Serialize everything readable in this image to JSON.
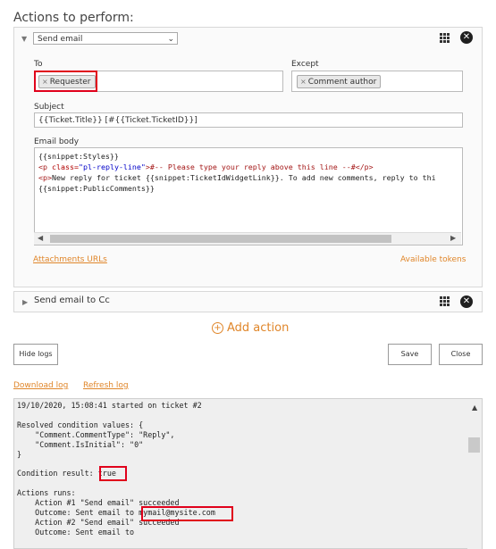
{
  "header": {
    "title": "Actions to perform:"
  },
  "action1": {
    "type_select": "Send email",
    "to": {
      "label": "To",
      "chip": "Requester"
    },
    "except": {
      "label": "Except",
      "chip": "Comment author"
    },
    "subject": {
      "label": "Subject",
      "value": "{{Ticket.Title}} [#{{Ticket.TicketID}}]"
    },
    "email_body": {
      "label": "Email body",
      "lines": [
        "{{snippet:Styles}}",
        "<p class=\"pl-reply-line\">#-- Please type your reply above this line --#</p>",
        "<p>New reply for ticket {{snippet:TicketIdWidgetLink}}. To add new comments, reply to thi",
        "{{snippet:PublicComments}}"
      ],
      "line2": {
        "p1": "<p ",
        "attr": "class=",
        "str": "\"pl-reply-line\"",
        "p2": ">#-- Please type your reply above this line --#</p>"
      },
      "line3": {
        "tag": "<p>",
        "text": "New reply for ticket {{snippet:TicketIdWidgetLink}}. To add new comments, reply to thi"
      }
    },
    "attachments_link": "Attachments URLs",
    "available_tokens_link": "Available tokens"
  },
  "action2": {
    "title": "Send email to Cc"
  },
  "add_action": "Add action",
  "buttons": {
    "hide_logs": "Hide logs",
    "save": "Save",
    "close": "Close"
  },
  "log_links": {
    "download": "Download log",
    "refresh": "Refresh log"
  },
  "log": {
    "header": "19/10/2020, 15:08:41 started on ticket #2",
    "resolved_title": "Resolved condition values: {",
    "resolved_1": "    \"Comment.CommentType\": \"Reply\",",
    "resolved_2": "    \"Comment.IsInitial\": \"0\"",
    "resolved_end": "}",
    "condition_label": "Condition result: ",
    "condition_value": "true",
    "actions_title": "Actions runs:",
    "action1_line": "    Action #1 \"Send email\" succeeded",
    "outcome1_prefix": "    Outcome: Sent email to ",
    "outcome1_email": "mymail@mysite.com",
    "action2_line": "    Action #2 \"Send email\" succeeded",
    "outcome2": "    Outcome: Sent email to"
  },
  "icons": {
    "grip": "grip-icon",
    "close": "close-circle-icon",
    "caret": "caret-icon",
    "add": "plus-circle-icon"
  },
  "colors": {
    "accent": "#e0862a",
    "highlight": "#e0001b"
  }
}
